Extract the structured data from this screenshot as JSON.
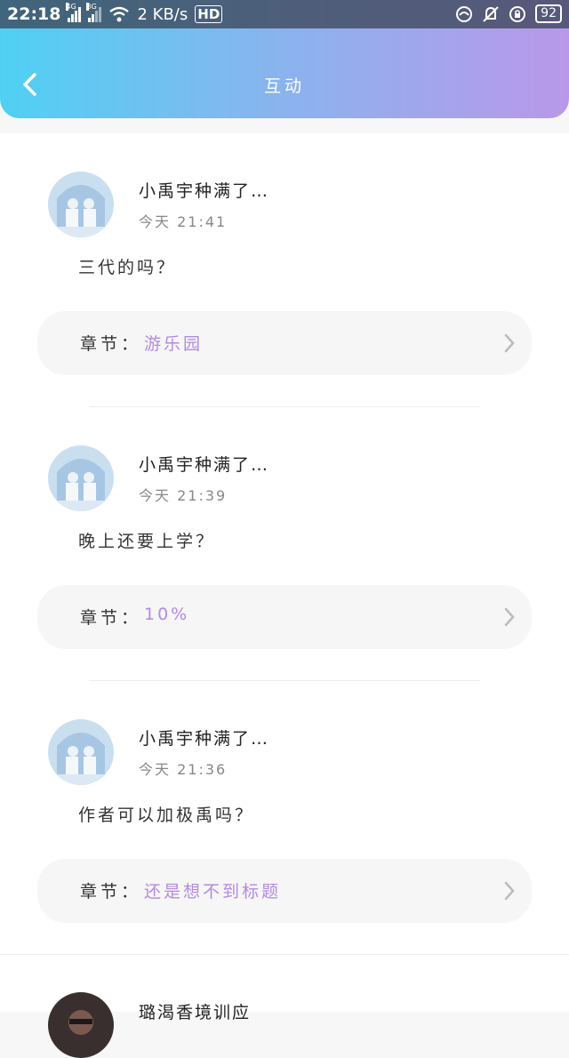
{
  "status_bar": {
    "time": "22:18",
    "signal1": "4G",
    "signal2": "3G",
    "speed": "2 KB/s",
    "hd": "HD",
    "battery": "92"
  },
  "header": {
    "title": "互动"
  },
  "cards": [
    {
      "user": "小禹宇种满了…",
      "time": "今天 21:41",
      "comment": "三代的吗？",
      "chapter_label": "章节：",
      "chapter": "游乐园"
    },
    {
      "user": "小禹宇种满了…",
      "time": "今天 21:39",
      "comment": "晚上还要上学？",
      "chapter_label": "章节：",
      "chapter": "10%"
    },
    {
      "user": "小禹宇种满了…",
      "time": "今天 21:36",
      "comment": "作者可以加极禹吗？",
      "chapter_label": "章节：",
      "chapter": "还是想不到标题"
    }
  ],
  "partial_card": {
    "user": "璐渴香境训应"
  },
  "colors": {
    "accent": "#b28be3",
    "gradient_start": "#4fd0f3",
    "gradient_end": "#b998ea"
  }
}
